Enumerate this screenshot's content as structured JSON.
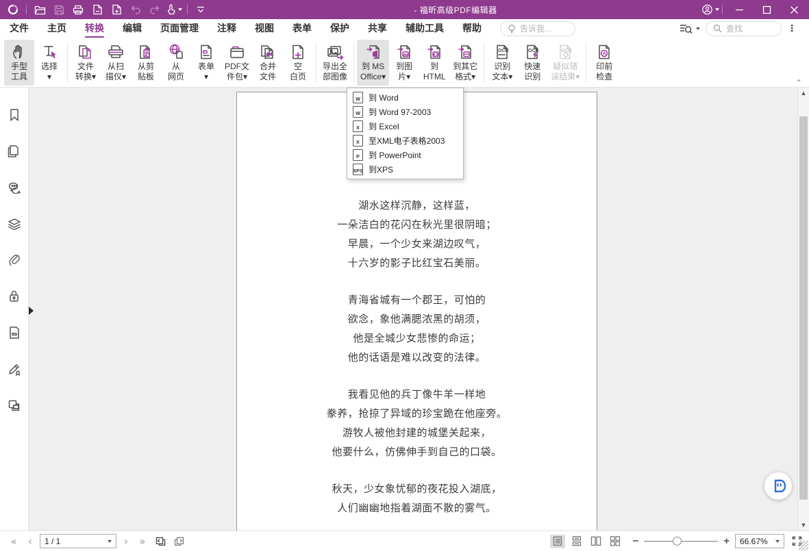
{
  "titlebar": {
    "title": "- 福昕高级PDF编辑器"
  },
  "menubar": {
    "tabs": [
      {
        "label": "文件"
      },
      {
        "label": "主页"
      },
      {
        "label": "转换"
      },
      {
        "label": "编辑"
      },
      {
        "label": "页面管理"
      },
      {
        "label": "注释"
      },
      {
        "label": "视图"
      },
      {
        "label": "表单"
      },
      {
        "label": "保护"
      },
      {
        "label": "共享"
      },
      {
        "label": "辅助工具"
      },
      {
        "label": "帮助"
      }
    ],
    "active_tab": "转换",
    "tell_me_placeholder": "告诉我...",
    "find_placeholder": "查找"
  },
  "ribbon": {
    "groups": [
      {
        "buttons": [
          {
            "label": "手型\n工具",
            "icon": "hand-tool-icon",
            "state": "pressed"
          },
          {
            "label": "选择\n▾",
            "icon": "select-tool-icon"
          }
        ]
      },
      {
        "buttons": [
          {
            "label": "文件\n转换▾",
            "icon": "convert-file-icon"
          },
          {
            "label": "从扫\n描仪▾",
            "icon": "from-scanner-icon"
          },
          {
            "label": "从剪\n贴板",
            "icon": "from-clipboard-icon"
          },
          {
            "label": "从\n网页",
            "icon": "from-web-icon"
          },
          {
            "label": "表单\n▾",
            "icon": "form-icon"
          },
          {
            "label": "PDF文\n件包▾",
            "icon": "pdf-portfolio-icon"
          },
          {
            "label": "合并\n文件",
            "icon": "combine-files-icon"
          },
          {
            "label": "空\n白页",
            "icon": "blank-page-icon"
          }
        ]
      },
      {
        "buttons": [
          {
            "label": "导出全\n部图像",
            "icon": "export-images-icon"
          }
        ]
      },
      {
        "buttons": [
          {
            "label": "到 MS\nOffice▾",
            "icon": "to-ms-office-icon",
            "state": "pressed"
          },
          {
            "label": "到图\n片▾",
            "icon": "to-image-icon"
          },
          {
            "label": "到\nHTML",
            "icon": "to-html-icon"
          },
          {
            "label": "到其它\n格式▾",
            "icon": "to-other-format-icon"
          }
        ]
      },
      {
        "buttons": [
          {
            "label": "识别\n文本▾",
            "icon": "ocr-text-icon"
          },
          {
            "label": "快速\n识别",
            "icon": "ocr-quick-icon"
          },
          {
            "label": "疑似错\n误结果▾",
            "icon": "ocr-suspects-icon",
            "state": "disabled"
          }
        ]
      },
      {
        "buttons": [
          {
            "label": "印前\n检查",
            "icon": "preflight-icon"
          }
        ]
      }
    ]
  },
  "dropdown": {
    "items": [
      {
        "badge": "W",
        "label": "到 Word"
      },
      {
        "badge": "W",
        "label": "到 Word 97-2003"
      },
      {
        "badge": "X",
        "label": "到 Excel"
      },
      {
        "badge": "X",
        "label": "至XML电子表格2003"
      },
      {
        "badge": "P",
        "label": "到 PowerPoint"
      },
      {
        "badge": "XPS",
        "label": "到XPS"
      }
    ]
  },
  "sidebar": {
    "icons": [
      "bookmarks-icon",
      "page-thumbnails-icon",
      "comments-icon",
      "layers-icon",
      "attachments-icon",
      "security-icon",
      "destinations-icon",
      "signatures-icon",
      "articles-icon"
    ]
  },
  "document": {
    "stanzas": [
      [
        "湖水这样沉静，这样蓝，",
        "一朵洁白的花闪在秋光里很阴暗；",
        "早晨，一个少女来湖边叹气，",
        "十六岁的影子比红宝石美丽。"
      ],
      [
        "青海省城有一个郡王，可怕的",
        "欲念，象他满腮浓黑的胡须，",
        "他是全城少女悲惨的命运；",
        "他的话语是难以改变的法律。"
      ],
      [
        "我看见他的兵丁像牛羊一样地",
        "豢养，抢掠了异域的珍宝跪在他座旁。",
        "游牧人被他封建的城堡关起来，",
        "他要什么，仿佛伸手到自己的口袋。"
      ],
      [
        "秋天，少女象忧郁的夜花投入湖底，",
        "人们幽幽地指着湖面不散的雾气。"
      ]
    ]
  },
  "statusbar": {
    "page_indicator": "1 / 1",
    "zoom_level": "66.67%"
  },
  "colors": {
    "titlebar": "#8e3a8e",
    "accent": "#8e3a8e",
    "icon_accent": "#a23aa2",
    "ai_button_blue": "#2f6fd6"
  }
}
